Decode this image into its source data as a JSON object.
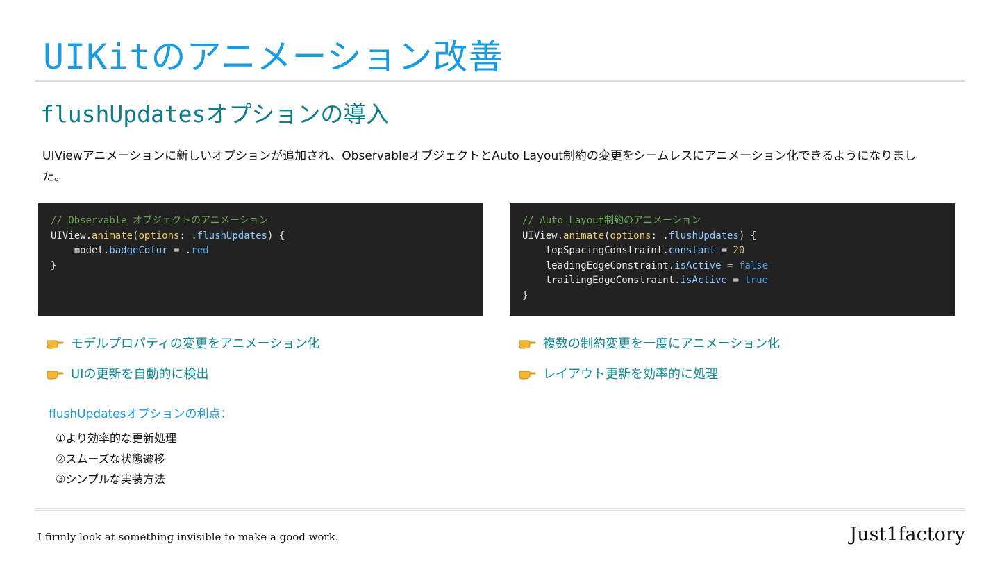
{
  "title": {
    "prefix": "UIKit",
    "suffix": "のアニメーション改善"
  },
  "subtitle": {
    "prefix": "flushUpdates",
    "suffix": "オプションの導入"
  },
  "description": "UIViewアニメーションに新しいオプションが追加され、ObservableオブジェクトとAuto Layout制約の変更をシームレスにアニメーション化できるようになりました。",
  "code_left": {
    "comment": "// Observable オブジェクトのアニメーション",
    "l1_obj": "UIView.",
    "l1_func": "animate",
    "l1_a": "(",
    "l1_arg": "options",
    "l1_b": ": .",
    "l1_prop": "flushUpdates",
    "l1_c": ") {",
    "l2_obj": "    model.",
    "l2_prop": "badgeColor",
    "l2_a": " = .",
    "l2_lit": "red",
    "l3": "}"
  },
  "code_right": {
    "comment": "// Auto Layout制約のアニメーション",
    "l1_obj": "UIView.",
    "l1_func": "animate",
    "l1_a": "(",
    "l1_arg": "options",
    "l1_b": ": .",
    "l1_prop": "flushUpdates",
    "l1_c": ") {",
    "l2_obj": "    topSpacingConstraint.",
    "l2_prop": "constant",
    "l2_a": " = ",
    "l2_lit": "20",
    "l3_obj": "    leadingEdgeConstraint.",
    "l3_prop": "isActive",
    "l3_a": " = ",
    "l3_lit": "false",
    "l4_obj": "    trailingEdgeConstraint.",
    "l4_prop": "isActive",
    "l4_a": " = ",
    "l4_lit": "true",
    "l5": "}"
  },
  "bullets_left": [
    "モデルプロパティの変更をアニメーション化",
    "UIの更新を自動的に検出"
  ],
  "bullets_right": [
    "複数の制約変更を一度にアニメーション化",
    "レイアウト更新を効率的に処理"
  ],
  "advantages": {
    "heading": "flushUpdatesオプションの利点：",
    "items": [
      "①より効率的な更新処理",
      "②スムーズな状態遷移",
      "③シンプルな実装方法"
    ]
  },
  "footer": {
    "tagline": "I firmly look at something invisible to make a good work.",
    "brand": "Just1factory"
  },
  "icons": {
    "bullet": "pointing-hand-icon"
  },
  "colors": {
    "title": "#1a9be0",
    "subtitle": "#0f7c8a",
    "bullet_text": "#0f8a96",
    "code_bg": "#222222"
  }
}
